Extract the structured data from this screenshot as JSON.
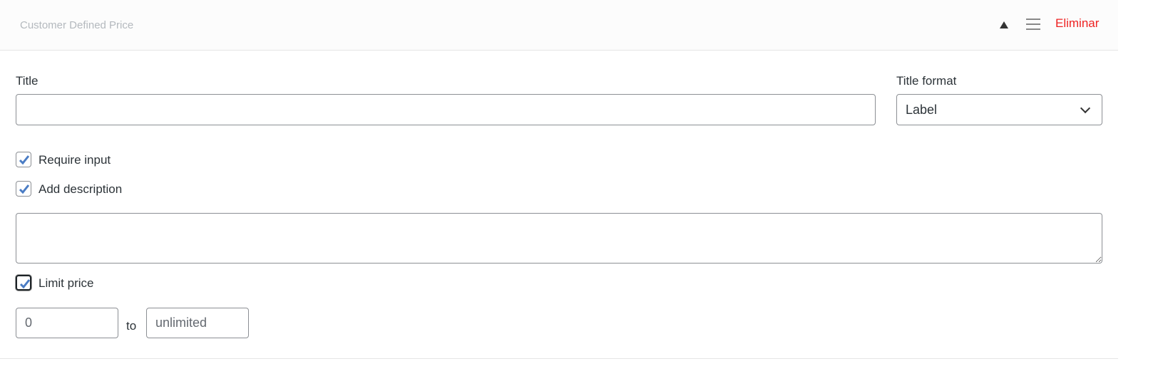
{
  "header": {
    "title": "Customer Defined Price",
    "delete_label": "Eliminar"
  },
  "form": {
    "title_label": "Title",
    "title_value": "",
    "title_format_label": "Title format",
    "title_format_value": "Label",
    "require_input_label": "Require input",
    "require_input_checked": true,
    "add_description_label": "Add description",
    "add_description_checked": true,
    "description_value": "",
    "limit_price_label": "Limit price",
    "limit_price_checked": true,
    "min_placeholder": "0",
    "max_placeholder": "unlimited",
    "to_label": "to"
  },
  "colors": {
    "accent": "#4a7cc4",
    "danger": "#ee2222"
  }
}
